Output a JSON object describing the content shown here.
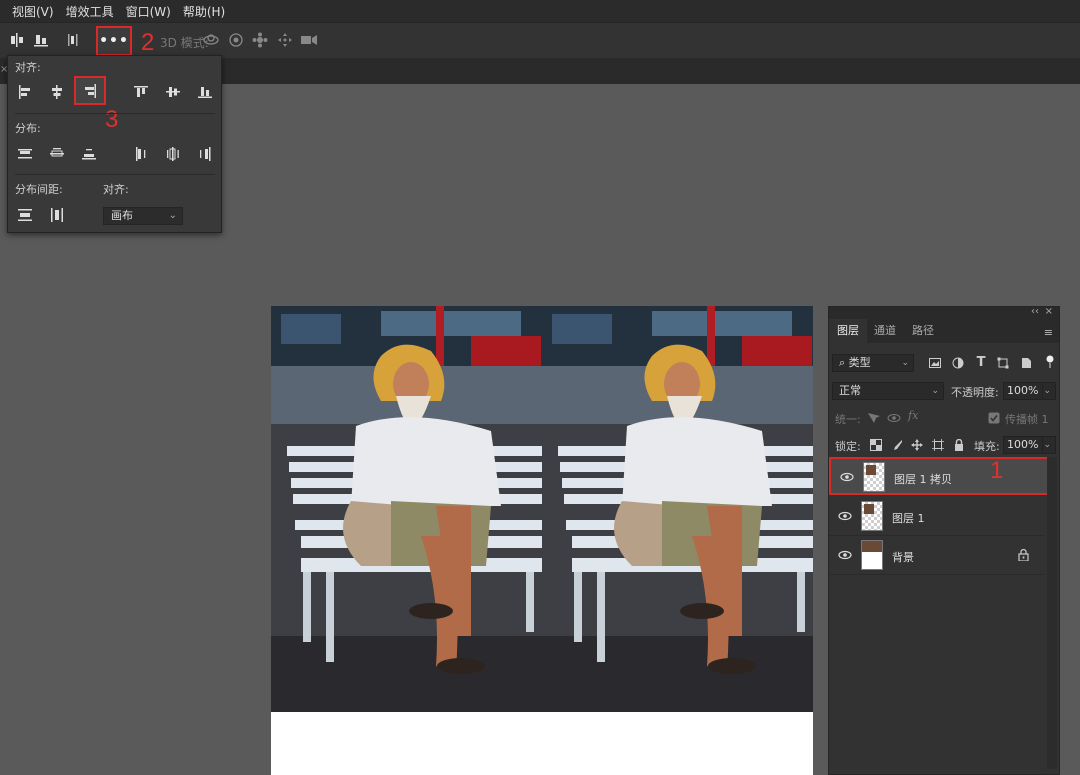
{
  "menubar": {
    "items": [
      "视图(V)",
      "增效工具",
      "窗口(W)",
      "帮助(H)"
    ]
  },
  "optionsbar": {
    "more_label": "•••",
    "mode_label": "3D 模式:"
  },
  "align_panel": {
    "align_label": "对齐:",
    "distribute_label": "分布:",
    "spacing_label": "分布间距:",
    "align_to_label": "对齐:",
    "align_to_value": "画布"
  },
  "annotations": {
    "a1": "1",
    "a2": "2",
    "a3": "3"
  },
  "layers_panel": {
    "tabs": [
      "图层",
      "通道",
      "路径"
    ],
    "filter_value": "类型",
    "blend_mode": "正常",
    "opacity_label": "不透明度:",
    "opacity_value": "100%",
    "unify_label": "统一:",
    "propagate_label": "传播帧 1",
    "lock_label": "锁定:",
    "fill_label": "填充:",
    "fill_value": "100%",
    "layers": [
      {
        "name": "图层 1 拷贝",
        "selected": true
      },
      {
        "name": "图层 1",
        "selected": false
      },
      {
        "name": "背景",
        "selected": false,
        "locked": true
      }
    ]
  },
  "colors": {
    "highlight": "#d92a2a",
    "panel_bg": "#323232",
    "canvas_bg": "#5a5a5a"
  }
}
